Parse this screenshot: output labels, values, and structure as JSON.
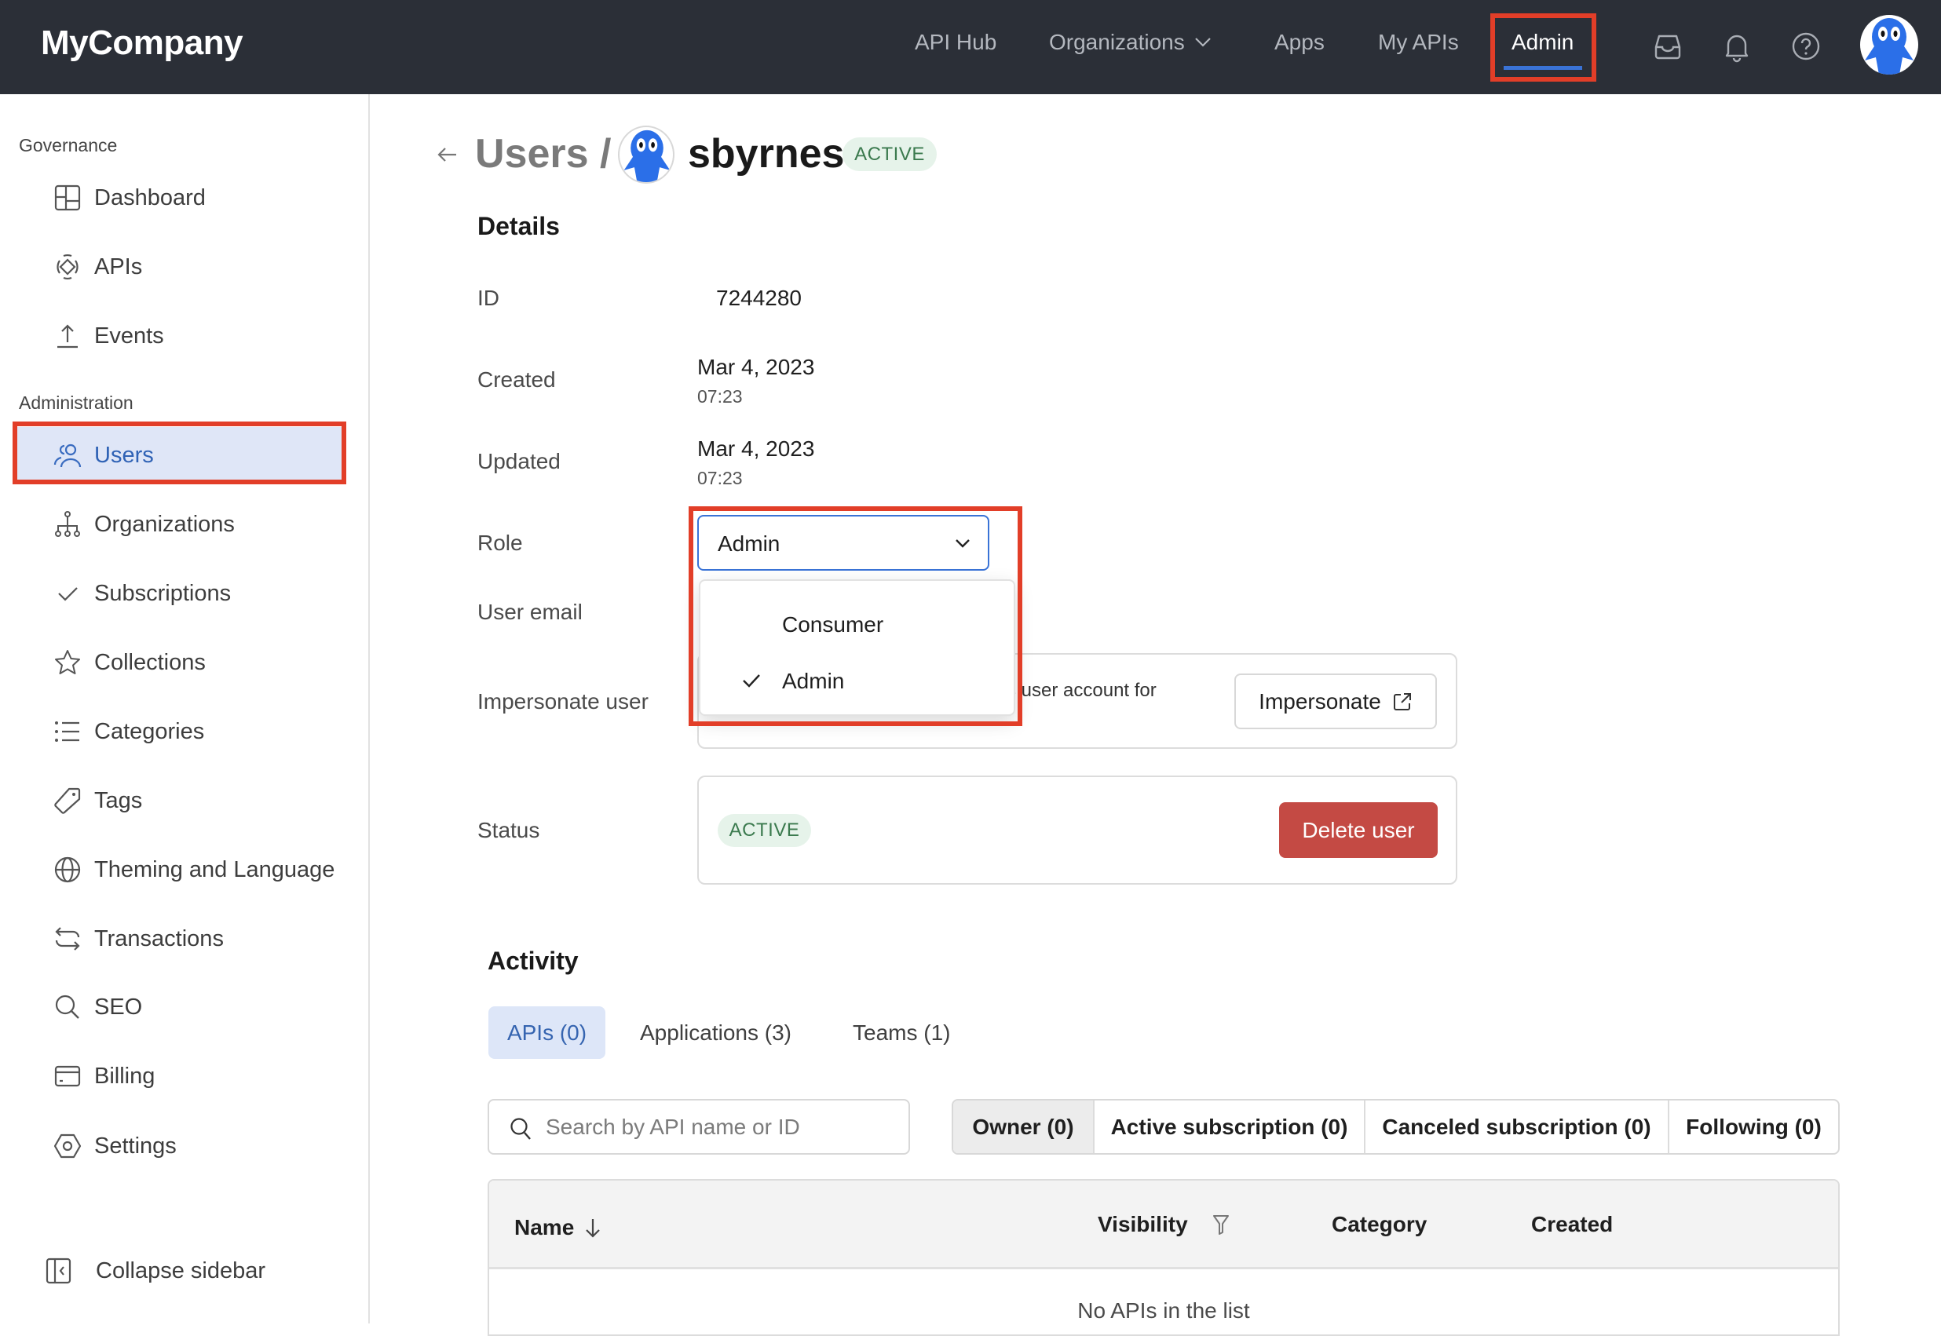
{
  "header": {
    "logo": "MyCompany",
    "nav": [
      {
        "label": "API Hub"
      },
      {
        "label": "Organizations",
        "has_dropdown": true
      },
      {
        "label": "Apps"
      },
      {
        "label": "My APIs"
      },
      {
        "label": "Admin",
        "active": true
      }
    ],
    "icons": [
      "inbox-icon",
      "bell-icon",
      "help-icon"
    ],
    "accent_color": "#3a73d6"
  },
  "sidebar": {
    "sections": [
      {
        "title": "Governance",
        "items": [
          {
            "label": "Dashboard",
            "icon": "dashboard-icon"
          },
          {
            "label": "APIs",
            "icon": "apis-icon"
          },
          {
            "label": "Events",
            "icon": "upload-icon"
          }
        ]
      },
      {
        "title": "Administration",
        "items": [
          {
            "label": "Users",
            "icon": "users-icon",
            "active": true
          },
          {
            "label": "Organizations",
            "icon": "hierarchy-icon"
          },
          {
            "label": "Subscriptions",
            "icon": "check-icon"
          },
          {
            "label": "Collections",
            "icon": "star-icon"
          },
          {
            "label": "Categories",
            "icon": "list-icon"
          },
          {
            "label": "Tags",
            "icon": "tag-icon"
          },
          {
            "label": "Theming and Language",
            "icon": "globe-icon"
          },
          {
            "label": "Transactions",
            "icon": "arrows-icon"
          },
          {
            "label": "SEO",
            "icon": "search-icon"
          },
          {
            "label": "Billing",
            "icon": "card-icon"
          },
          {
            "label": "Settings",
            "icon": "settings-icon"
          }
        ]
      }
    ],
    "collapse_label": "Collapse sidebar"
  },
  "page": {
    "breadcrumb_parent": "Users /",
    "username": "sbyrnes",
    "status_badge": "ACTIVE",
    "details_heading": "Details",
    "fields": {
      "id_label": "ID",
      "id_value": "7244280",
      "created_label": "Created",
      "created_date": "Mar 4, 2023",
      "created_time": "07:23",
      "updated_label": "Updated",
      "updated_date": "Mar 4, 2023",
      "updated_time": "07:23",
      "role_label": "Role",
      "role_value": "Admin",
      "email_label": "User email",
      "impersonate_label": "Impersonate user",
      "impersonate_text_partial": "ss user account for",
      "impersonate_button": "Impersonate",
      "status_label": "Status",
      "status_value": "ACTIVE",
      "delete_button": "Delete user"
    },
    "role_menu": {
      "options": [
        {
          "label": "Consumer",
          "selected": false
        },
        {
          "label": "Admin",
          "selected": true
        }
      ]
    },
    "activity": {
      "heading": "Activity",
      "tabs": [
        {
          "label": "APIs (0)",
          "active": true
        },
        {
          "label": "Applications (3)"
        },
        {
          "label": "Teams (1)"
        }
      ],
      "search_placeholder": "Search by API name or ID",
      "filters": [
        {
          "label": "Owner (0)",
          "active": true
        },
        {
          "label": "Active subscription (0)"
        },
        {
          "label": "Canceled subscription (0)"
        },
        {
          "label": "Following (0)"
        }
      ],
      "table": {
        "columns": [
          "Name",
          "Visibility",
          "Category",
          "Created"
        ],
        "empty_text": "No APIs in the list"
      }
    },
    "colors": {
      "active_badge_bg": "#e6f3ea",
      "active_badge_text": "#3b7a4e",
      "danger": "#c44a44",
      "highlight_box": "#e23e28"
    }
  }
}
